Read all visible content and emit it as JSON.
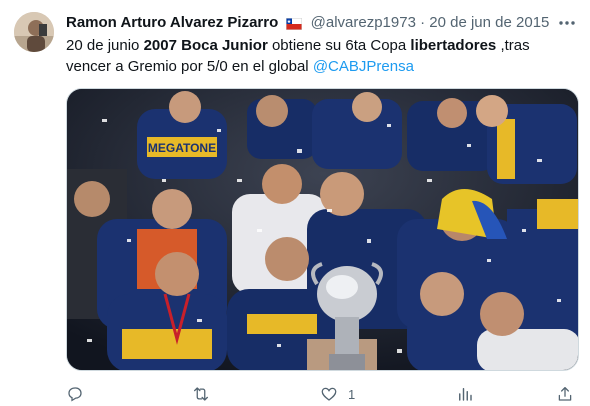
{
  "tweet": {
    "author_name": "Ramon Arturo Alvarez Pizarro",
    "handle": "@alvarezp1973",
    "separator": "·",
    "date": "20 de jun de 2015",
    "text": {
      "p1": "20 de junio ",
      "b1": "2007 Boca Junior",
      "p2": " obtiene su 6ta Copa ",
      "b2": "libertadores",
      "p3": " ,tras vencer a Gremio por 5/0 en el global ",
      "mention": "@CABJPrensa"
    },
    "photo_sign": "MEGATONE"
  },
  "actions": {
    "reply": {
      "icon": "reply-icon",
      "count": ""
    },
    "retweet": {
      "icon": "retweet-icon",
      "count": ""
    },
    "like": {
      "icon": "heart-icon",
      "count": "1"
    },
    "views": {
      "icon": "views-icon",
      "count": ""
    },
    "share": {
      "icon": "share-icon",
      "count": ""
    }
  },
  "colors": {
    "text": "#0f1419",
    "secondary": "#536471",
    "link": "#1d9bf0",
    "boca_blue": "#152a63",
    "boca_gold": "#e7b928"
  }
}
